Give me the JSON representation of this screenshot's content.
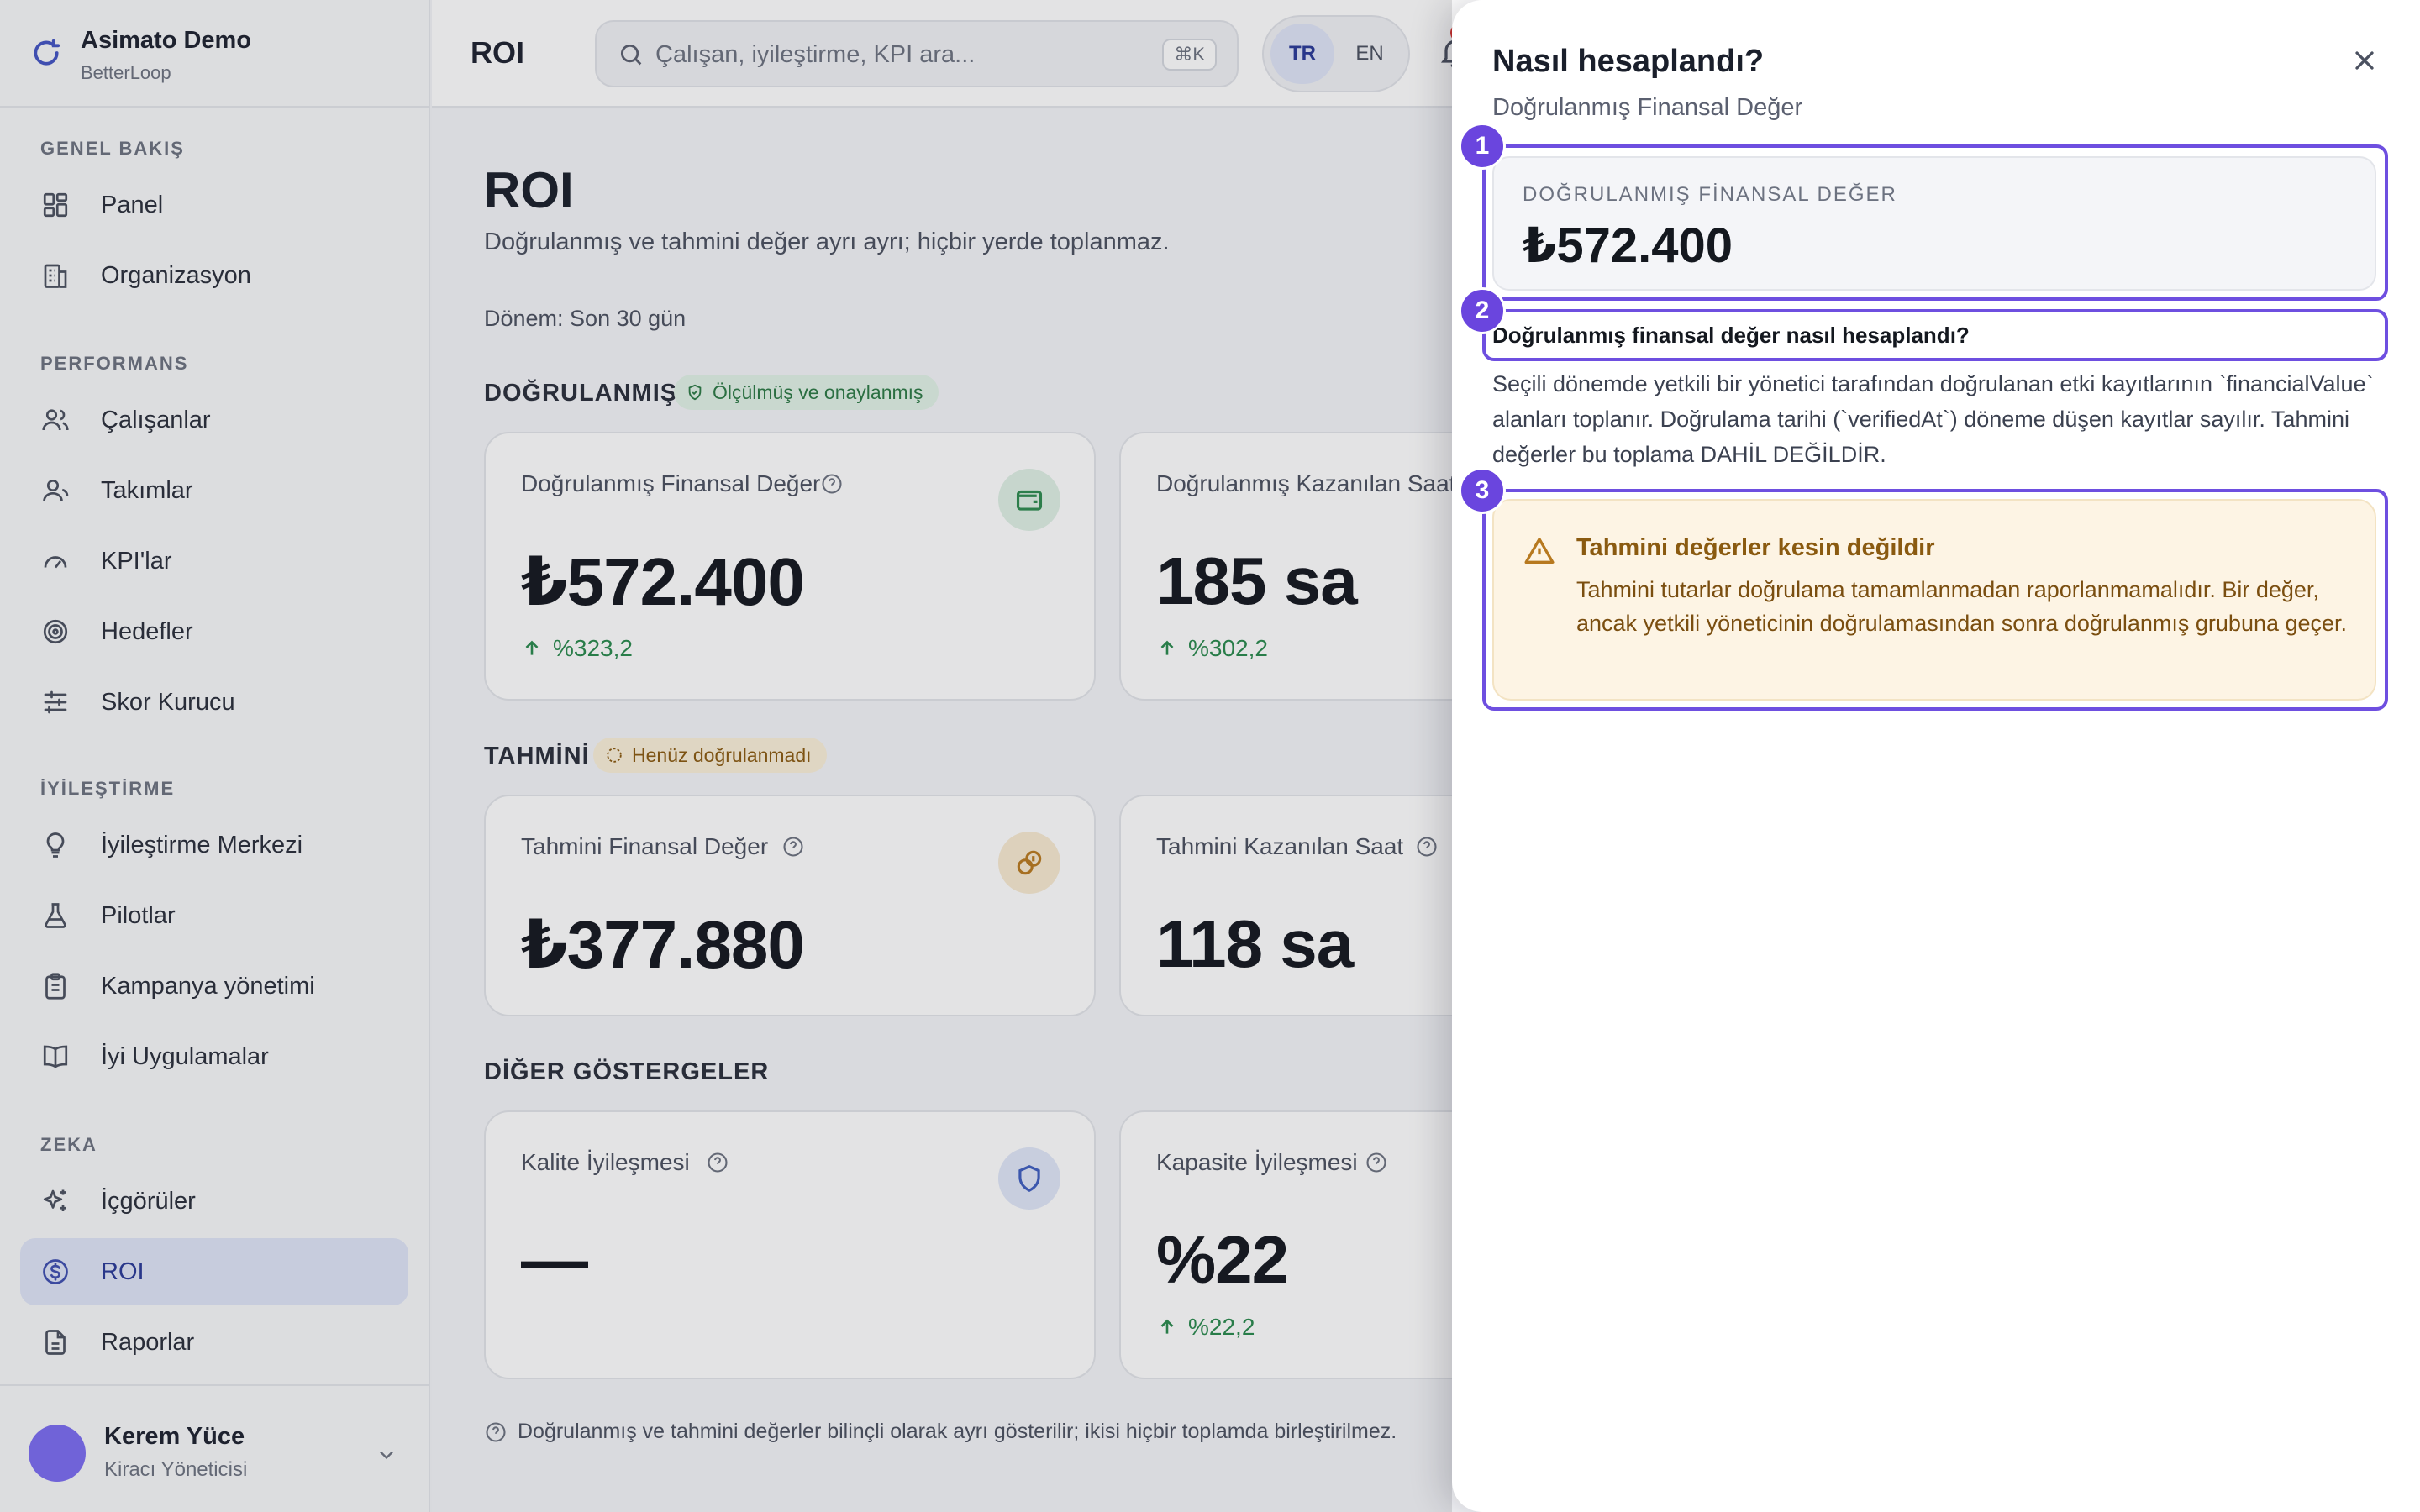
{
  "app": {
    "name": "Asimato Demo",
    "org": "BetterLoop"
  },
  "sidebar": {
    "sections": [
      {
        "label": "GENEL BAKIŞ"
      },
      {
        "label": "PERFORMANS"
      },
      {
        "label": "İYİLEŞTİRME"
      },
      {
        "label": "ZEKA"
      }
    ],
    "items": [
      {
        "label": "Panel",
        "icon": "grid-icon"
      },
      {
        "label": "Organizasyon",
        "icon": "building-icon"
      },
      {
        "label": "Çalışanlar",
        "icon": "users-icon"
      },
      {
        "label": "Takımlar",
        "icon": "team-icon"
      },
      {
        "label": "KPI'lar",
        "icon": "gauge-icon"
      },
      {
        "label": "Hedefler",
        "icon": "target-icon"
      },
      {
        "label": "Skor Kurucu",
        "icon": "sliders-icon"
      },
      {
        "label": "İyileştirme Merkezi",
        "icon": "lightbulb-icon"
      },
      {
        "label": "Pilotlar",
        "icon": "flask-icon"
      },
      {
        "label": "Kampanya yönetimi",
        "icon": "clipboard-icon"
      },
      {
        "label": "İyi Uygulamalar",
        "icon": "book-icon"
      },
      {
        "label": "İçgörüler",
        "icon": "sparkles-icon"
      },
      {
        "label": "ROI",
        "icon": "dollar-circle-icon",
        "active": true
      },
      {
        "label": "Raporlar",
        "icon": "file-icon"
      }
    ],
    "user": {
      "name": "Kerem Yüce",
      "role": "Kiracı Yöneticisi"
    }
  },
  "header": {
    "title": "ROI",
    "search_placeholder": "Çalışan, iyileştirme, KPI ara...",
    "shortcut": "⌘K",
    "lang": {
      "tr": "TR",
      "en": "EN",
      "selected": "TR"
    }
  },
  "main": {
    "title": "ROI",
    "subtitle": "Doğrulanmış ve tahmini değer ayrı ayrı; hiçbir yerde toplanmaz.",
    "period": "Dönem: Son 30 gün",
    "verified": {
      "heading": "DOĞRULANMIŞ",
      "badge": "Ölçülmüş ve onaylanmış",
      "cards": [
        {
          "title": "Doğrulanmış Finansal Değer",
          "value": "₺572.400",
          "delta": "%323,2"
        },
        {
          "title": "Doğrulanmış Kazanılan Saat",
          "value": "185 sa",
          "delta": "%302,2"
        }
      ]
    },
    "estimated": {
      "heading": "TAHMİNİ",
      "badge": "Henüz doğrulanmadı",
      "cards": [
        {
          "title": "Tahmini Finansal Değer",
          "value": "₺377.880"
        },
        {
          "title": "Tahmini Kazanılan Saat",
          "value": "118 sa"
        }
      ]
    },
    "other": {
      "heading": "DİĞER GÖSTERGELER",
      "cards": [
        {
          "title": "Kalite İyileşmesi",
          "value": "—"
        },
        {
          "title": "Kapasite İyileşmesi",
          "value": "%22",
          "delta": "%22,2"
        }
      ]
    },
    "footnote": "Doğrulanmış ve tahmini değerler bilinçli olarak ayrı gösterilir; ikisi hiçbir toplamda birleştirilmez."
  },
  "drawer": {
    "title": "Nasıl hesaplandı?",
    "subtitle": "Doğrulanmış Finansal Değer",
    "steps": [
      "1",
      "2",
      "3"
    ],
    "value_label": "DOĞRULANMIŞ FİNANSAL DEĞER",
    "value": "₺572.400",
    "question": "Doğrulanmış finansal değer nasıl hesaplandı?",
    "explanation": "Seçili dönemde yetkili bir yönetici tarafından doğrulanan etki kayıtlarının `financialValue` alanları toplanır. Doğrulama tarihi (`verifiedAt`) döneme düşen kayıtlar sayılır. Tahmini değerler bu toplama DAHİL DEĞİLDİR.",
    "warning_title": "Tahmini değerler kesin değildir",
    "warning_text": "Tahmini tutarlar doğrulama tamamlanmadan raporlanmamalıdır. Bir değer, ancak yetkili yöneticinin doğrulamasından sonra doğrulanmış grubuna geçer."
  },
  "colors": {
    "accent": "#3f4fb0",
    "highlight": "#6e4fe0",
    "positive": "#2a8a4e",
    "warning_bg": "#fdf4e4"
  }
}
